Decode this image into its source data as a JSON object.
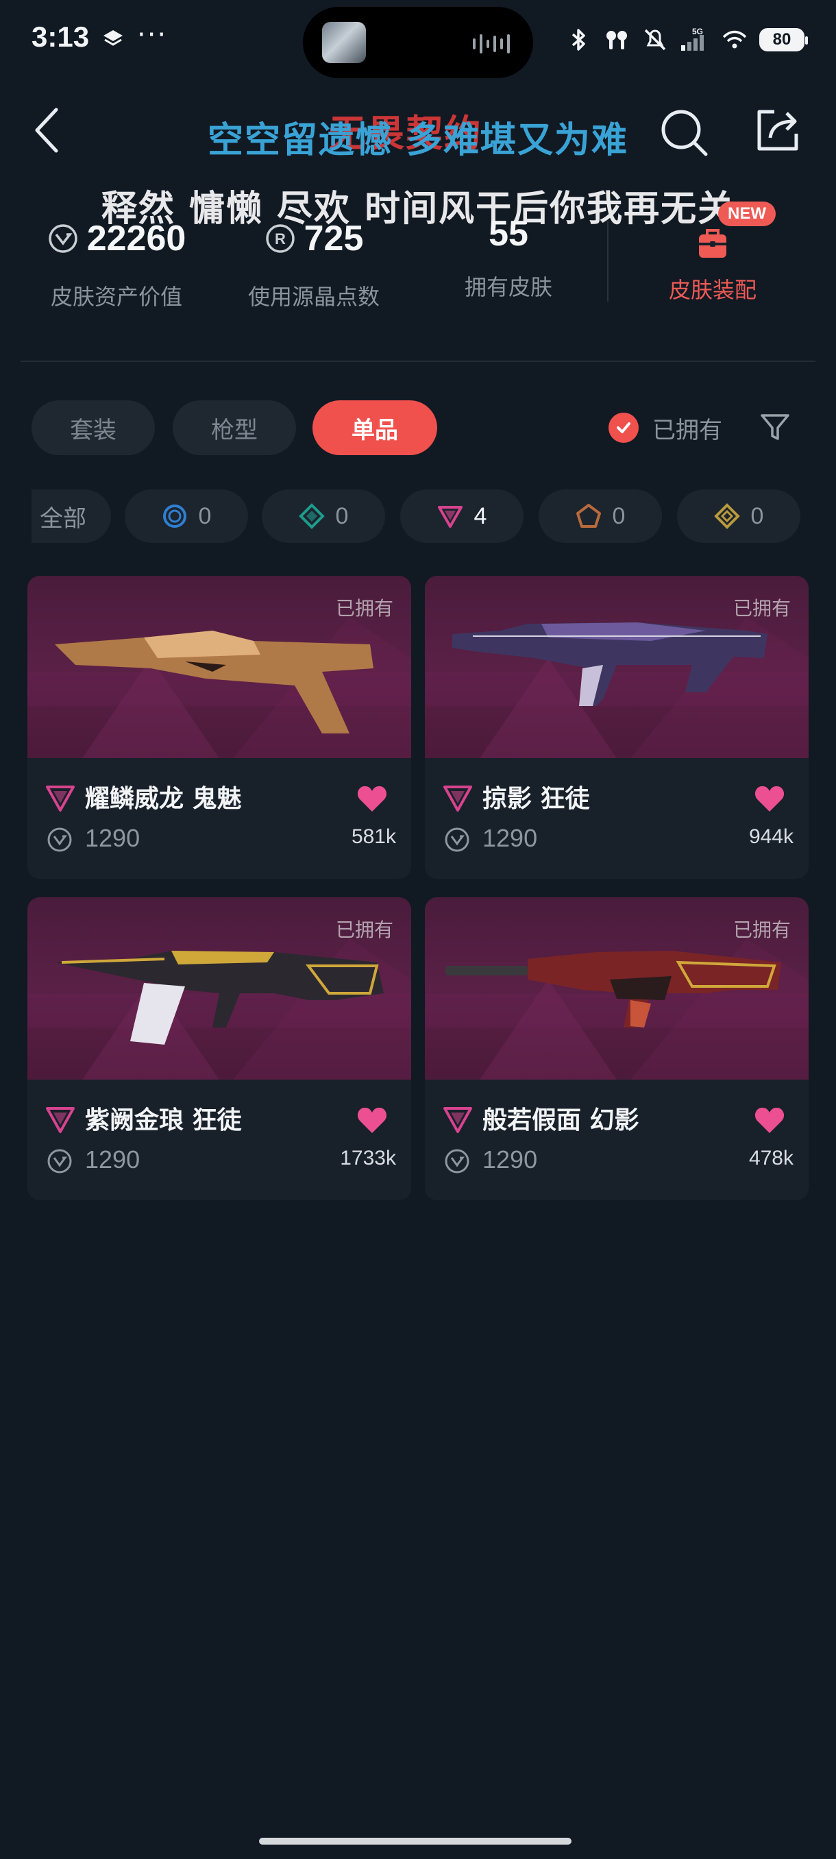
{
  "status_bar": {
    "time": "3:13",
    "dots": "···",
    "network": "5G",
    "battery": "80"
  },
  "header": {
    "ghost_title": "无畏契约",
    "lyric_line1": "空空留遗憾 多难堪又为难",
    "lyric_line2": "释然 慵懒 尽欢 时间风干后你我再无关"
  },
  "stats": [
    {
      "value": "22260",
      "label": "皮肤资产价值",
      "icon": "valorant-points-icon"
    },
    {
      "value": "725",
      "label": "使用源晶点数",
      "icon": "radianite-icon"
    },
    {
      "value": "55",
      "label": "拥有皮肤",
      "icon": ""
    }
  ],
  "equip": {
    "label": "皮肤装配",
    "badge": "NEW"
  },
  "tabs": [
    {
      "label": "套装",
      "active": false
    },
    {
      "label": "枪型",
      "active": false
    },
    {
      "label": "单品",
      "active": true
    }
  ],
  "owned_filter": {
    "label": "已拥有",
    "checked": true
  },
  "tier_chips": [
    {
      "label": "全部",
      "count": "",
      "tier": "all"
    },
    {
      "label": "",
      "count": "0",
      "tier": "select",
      "color": "#2f7fd0"
    },
    {
      "label": "",
      "count": "0",
      "tier": "deluxe",
      "color": "#1e9b8c"
    },
    {
      "label": "",
      "count": "4",
      "tier": "premium",
      "color": "#d6438e"
    },
    {
      "label": "",
      "count": "0",
      "tier": "ultra",
      "color": "#b86a3c"
    },
    {
      "label": "",
      "count": "0",
      "tier": "exclusive",
      "color": "#b89a3c"
    }
  ],
  "cards": [
    {
      "name": "耀鳞威龙 鬼魅",
      "price": "1290",
      "likes": "581k",
      "owned": "已拥有"
    },
    {
      "name": "掠影 狂徒",
      "price": "1290",
      "likes": "944k",
      "owned": "已拥有"
    },
    {
      "name": "紫阙金琅 狂徒",
      "price": "1290",
      "likes": "1733k",
      "owned": "已拥有"
    },
    {
      "name": "般若假面 幻影",
      "price": "1290",
      "likes": "478k",
      "owned": "已拥有"
    }
  ],
  "colors": {
    "background": "#111923",
    "accent": "#f0514d",
    "lyric_blue": "#3aa3d6",
    "premium_tier": "#d6438e",
    "heart": "#ec4f92"
  }
}
